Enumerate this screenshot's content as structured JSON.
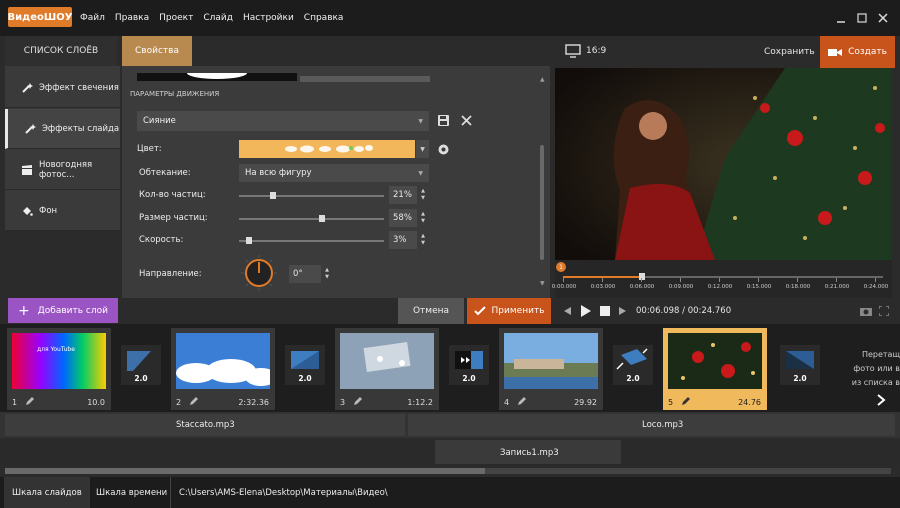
{
  "app": {
    "logo_part1": "Видео",
    "logo_part2": "ШОУ"
  },
  "menu": [
    "Файл",
    "Правка",
    "Проект",
    "Слайд",
    "Настройки",
    "Справка"
  ],
  "tabs": {
    "layers": "СПИСОК СЛОЁВ",
    "properties": "Свойства"
  },
  "layers": [
    {
      "label": "Эффект свечения",
      "icon": "wand-icon"
    },
    {
      "label": "Эффекты слайда",
      "icon": "wand-icon"
    },
    {
      "label": "Новогодняя фотос...",
      "icon": "clapper-icon"
    },
    {
      "label": "Фон",
      "icon": "paint-bucket-icon"
    }
  ],
  "props": {
    "section_title": "ПАРАМЕТРЫ ДВИЖЕНИЯ",
    "preset_value": "Сияние",
    "color_label": "Цвет:",
    "wrap_label": "Обтекание:",
    "wrap_value": "На всю фигуру",
    "particles_label": "Кол-во частиц:",
    "particles_value": "21%",
    "particles_level": 0.21,
    "size_label": "Размер частиц:",
    "size_value": "58%",
    "size_level": 0.58,
    "speed_label": "Скорость:",
    "speed_value": "3%",
    "speed_level": 0.03,
    "direction_label": "Направление:",
    "direction_value": "0°",
    "accent_color": "#f2b75a"
  },
  "preview": {
    "aspect": "16:9",
    "save_label": "Сохранить",
    "create_label": "Создать",
    "time_current": "00:06.098",
    "time_total": "00:24.760",
    "ticks": [
      "0:00.000",
      "0:03.000",
      "0:06.000",
      "0:09.000",
      "0:12.000",
      "0:15.000",
      "0:18.000",
      "0:21.000",
      "0:24.000"
    ],
    "playhead_marker": "1"
  },
  "buttons": {
    "add_layer": "Добавить слой",
    "cancel": "Отмена",
    "apply": "Применить"
  },
  "slides": [
    {
      "num": "1",
      "duration": "10.0",
      "thumb_text": "для YouTube"
    },
    {
      "num": "2",
      "duration": "2:32.36"
    },
    {
      "num": "3",
      "duration": "1:12.2"
    },
    {
      "num": "4",
      "duration": "29.92"
    },
    {
      "num": "5",
      "duration": "24.76"
    }
  ],
  "transitions": [
    "2.0",
    "2.0",
    "2.0",
    "2.0",
    "2.0",
    "2.0"
  ],
  "drop_hint": [
    "Перетащ",
    "фото или в",
    "из списка в"
  ],
  "audio": {
    "track1": "Staccato.mp3",
    "track2": "Loco.mp3",
    "recording": "Запись1.mp3"
  },
  "status": {
    "tab_slides": "Шкала слайдов",
    "tab_timeline": "Шкала времени",
    "path": "C:\\Users\\AMS-Elena\\Desktop\\Материалы\\Видео\\"
  }
}
